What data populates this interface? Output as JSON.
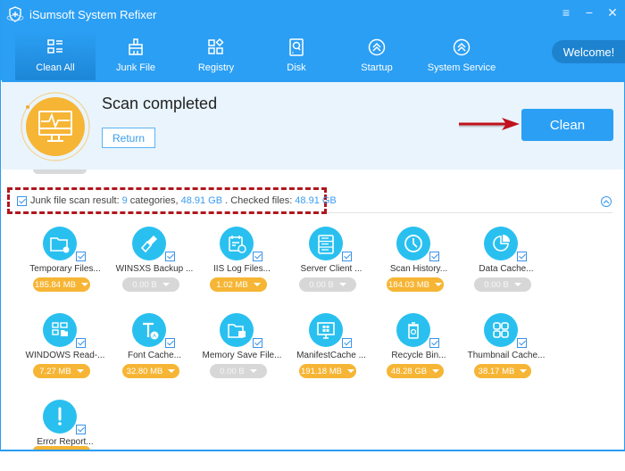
{
  "window": {
    "title": "iSumsoft System Refixer",
    "controls": [
      {
        "name": "menu-icon",
        "glyph": "≡"
      },
      {
        "name": "minimize-icon",
        "glyph": "−"
      },
      {
        "name": "close-icon",
        "glyph": "✕"
      }
    ]
  },
  "nav": {
    "items": [
      {
        "label": "Clean All",
        "icon": "list-grid-icon",
        "active": true
      },
      {
        "label": "Junk File",
        "icon": "brush-icon",
        "active": false
      },
      {
        "label": "Registry",
        "icon": "registry-icon",
        "active": false
      },
      {
        "label": "Disk",
        "icon": "disk-icon",
        "active": false
      },
      {
        "label": "Startup",
        "icon": "startup-icon",
        "active": false
      },
      {
        "label": "System Service",
        "icon": "service-icon",
        "active": false
      }
    ],
    "welcome": "Welcome!"
  },
  "banner": {
    "status": "Scan completed",
    "return_label": "Return",
    "clean_label": "Clean"
  },
  "summary": {
    "prefix": "Junk file scan result:",
    "categories_count": "9",
    "categories_word": "categories,",
    "total_size": "48.91 GB",
    "checked_label": ". Checked files:",
    "checked_size": "48.91 GB"
  },
  "categories": [
    {
      "label": "Temporary Files...",
      "size": "185.84 MB",
      "active": true,
      "icon": "folder-icon"
    },
    {
      "label": "WINSXS Backup ...",
      "size": "0.00 B",
      "active": false,
      "icon": "brush-icon"
    },
    {
      "label": "IIS Log Files...",
      "size": "1.02 MB",
      "active": true,
      "icon": "calendar-clock-icon"
    },
    {
      "label": "Server Client ...",
      "size": "0.00 B",
      "active": false,
      "icon": "server-icon"
    },
    {
      "label": "Scan History...",
      "size": "184.03 MB",
      "active": true,
      "icon": "clock-icon"
    },
    {
      "label": "Data Cache...",
      "size": "0.00 B",
      "active": false,
      "icon": "pie-chart-icon"
    },
    {
      "label": "WINDOWS Read-...",
      "size": "7.27 MB",
      "active": true,
      "icon": "windows-folder-icon"
    },
    {
      "label": "Font Cache...",
      "size": "32.80 MB",
      "active": true,
      "icon": "font-icon"
    },
    {
      "label": "Memory Save File...",
      "size": "0.00 B",
      "active": false,
      "icon": "memory-folder-icon"
    },
    {
      "label": "ManifestCache ...",
      "size": "191.18 MB",
      "active": true,
      "icon": "monitor-windows-icon"
    },
    {
      "label": "Recycle Bin...",
      "size": "48.28 GB",
      "active": true,
      "icon": "recycle-bin-icon"
    },
    {
      "label": "Thumbnail Cache...",
      "size": "38.17 MB",
      "active": true,
      "icon": "thumbnail-grid-icon"
    },
    {
      "label": "Error Report...",
      "size": "",
      "active": true,
      "icon": "exclamation-icon"
    }
  ],
  "colors": {
    "primary": "#2b9ff4",
    "active_pill": "#f6b534",
    "inactive_pill": "#d7d7d7",
    "icon_circle": "#29c0f0",
    "highlight_box": "#b0161e"
  }
}
